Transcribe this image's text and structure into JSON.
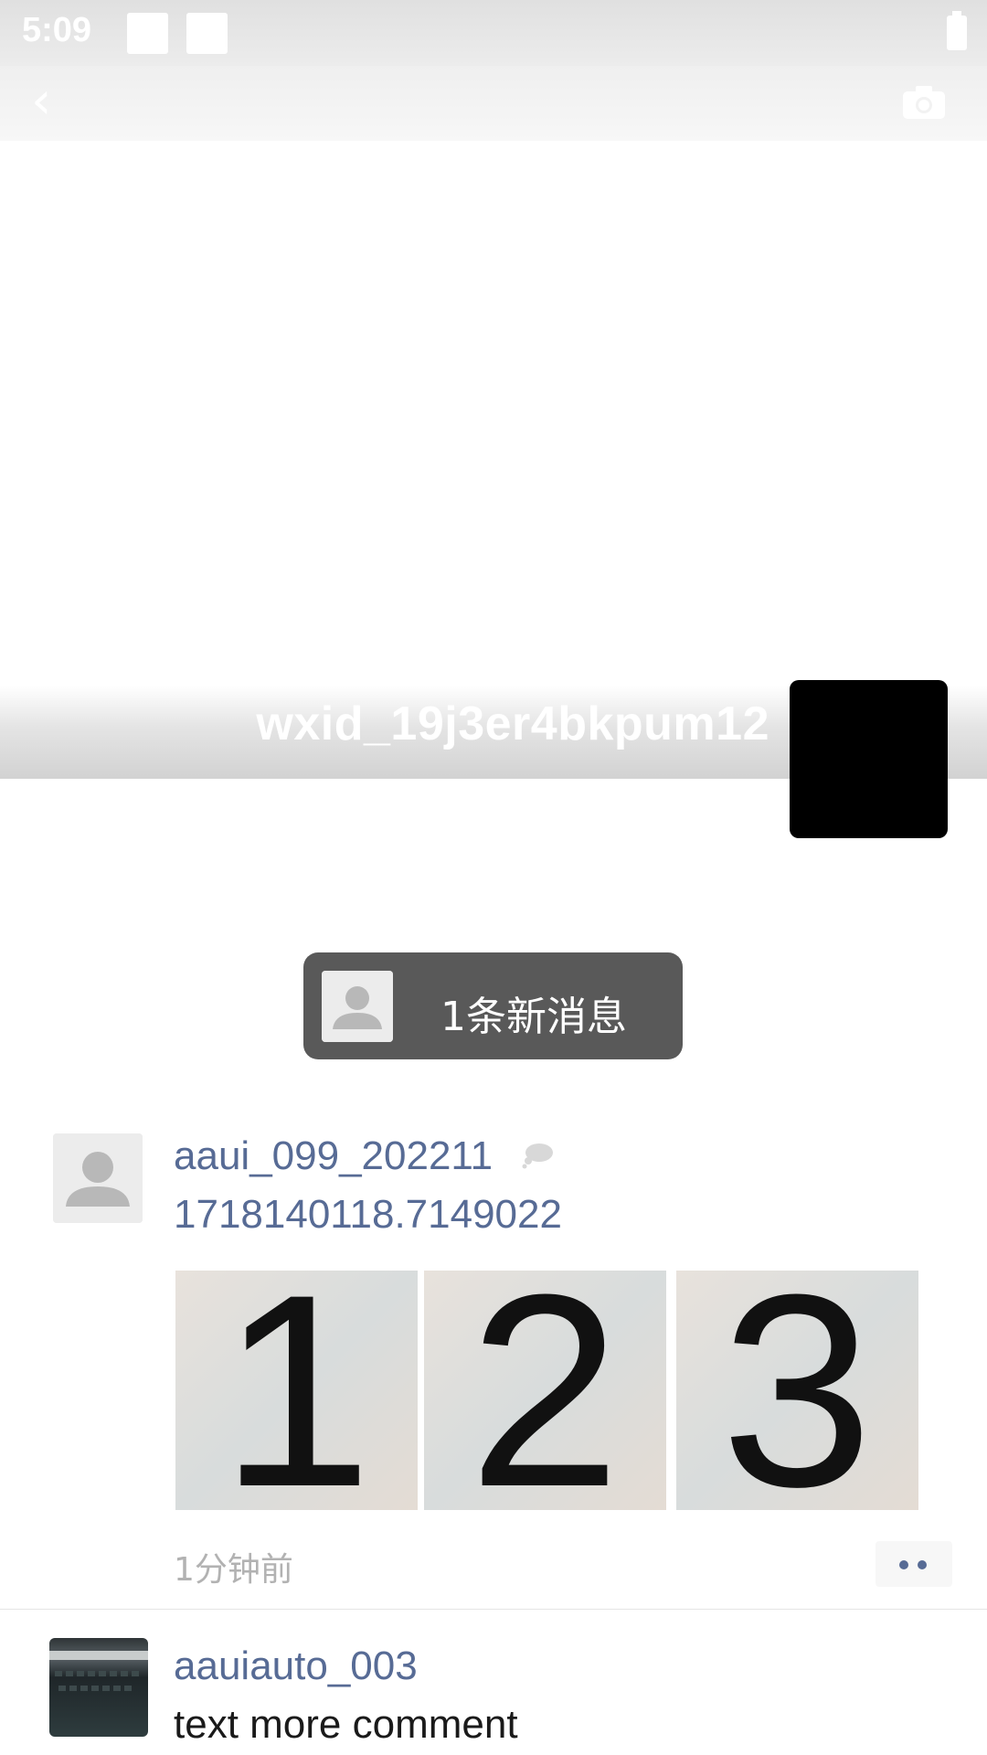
{
  "status_bar": {
    "time": "5:09"
  },
  "profile": {
    "nickname": "wxid_19j3er4bkpum12"
  },
  "new_message_notice": {
    "text": "1条新消息"
  },
  "posts": [
    {
      "author": "aaui_099_202211",
      "text": "1718140118.7149022",
      "photos": [
        "1",
        "2",
        "3"
      ],
      "time": "1分钟前"
    },
    {
      "author": "aauiauto_003",
      "text": "text more comment"
    }
  ],
  "icons": {
    "back": "back-arrow-icon",
    "camera": "camera-icon",
    "comment_bubble": "comment-cloud-icon",
    "more": "more-dots-icon"
  },
  "colors": {
    "link": "#576b95",
    "notice_bg": "#595959",
    "time_gray": "#b2b2b2"
  }
}
